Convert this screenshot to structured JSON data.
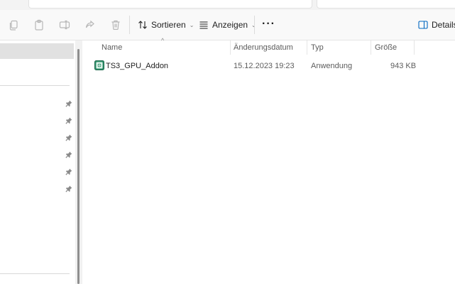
{
  "toolbar": {
    "sort_label": "Sortieren",
    "view_label": "Anzeigen",
    "more_label": "···",
    "details_label": "Details",
    "icons": [
      "copy-icon",
      "paste-icon",
      "rename-icon",
      "share-icon",
      "delete-icon"
    ]
  },
  "columns": {
    "name": "Name",
    "modified": "Änderungsdatum",
    "type": "Typ",
    "size": "Größe"
  },
  "files": [
    {
      "name": "TS3_GPU_Addon",
      "modified": "15.12.2023 19:23",
      "type": "Anwendung",
      "size": "943 KB",
      "icon": "application-icon"
    }
  ],
  "colors": {
    "toolbar_bg": "#f9f9f9",
    "nav_selected": "#e1e1e1",
    "accent": "#0067c0"
  }
}
